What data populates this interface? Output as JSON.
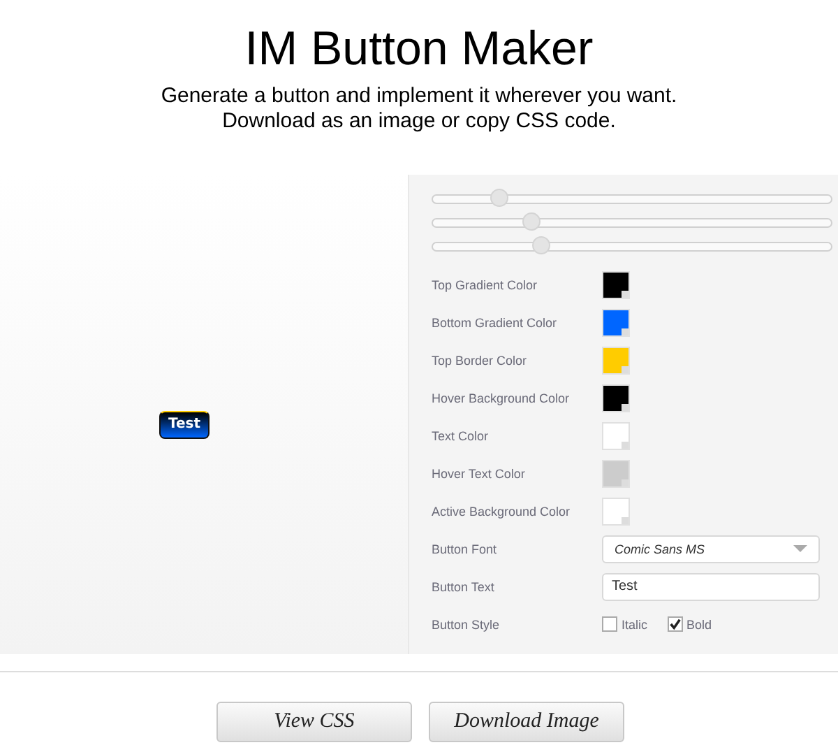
{
  "header": {
    "title": "IM Button Maker",
    "subtitle_lines": [
      "Generate a button and implement it wherever you want.",
      "Download as an image or copy CSS code."
    ]
  },
  "preview": {
    "text": "Test"
  },
  "sliders": [
    {
      "level": 0.17
    },
    {
      "level": 0.25
    },
    {
      "level": 0.275
    }
  ],
  "colors": [
    {
      "label": "Top Gradient Color",
      "color": "#000000"
    },
    {
      "label": "Bottom Gradient Color",
      "color": "#0066ff"
    },
    {
      "label": "Top Border Color",
      "color": "#ffcc00"
    },
    {
      "label": "Hover Background Color",
      "color": "#000000"
    },
    {
      "label": "Text Color",
      "color": "#ffffff"
    },
    {
      "label": "Hover Text Color",
      "color": "#cccccc"
    },
    {
      "label": "Active Background Color",
      "color": "#ffffff"
    }
  ],
  "font_field": {
    "label": "Button Font",
    "value": "Comic Sans MS"
  },
  "text_field": {
    "label": "Button Text",
    "value": "Test"
  },
  "style_field": {
    "label": "Button Style",
    "options": [
      {
        "label": "Italic",
        "checked": false
      },
      {
        "label": "Bold",
        "checked": true
      }
    ]
  },
  "buttons": [
    "View CSS",
    "Download Image"
  ]
}
